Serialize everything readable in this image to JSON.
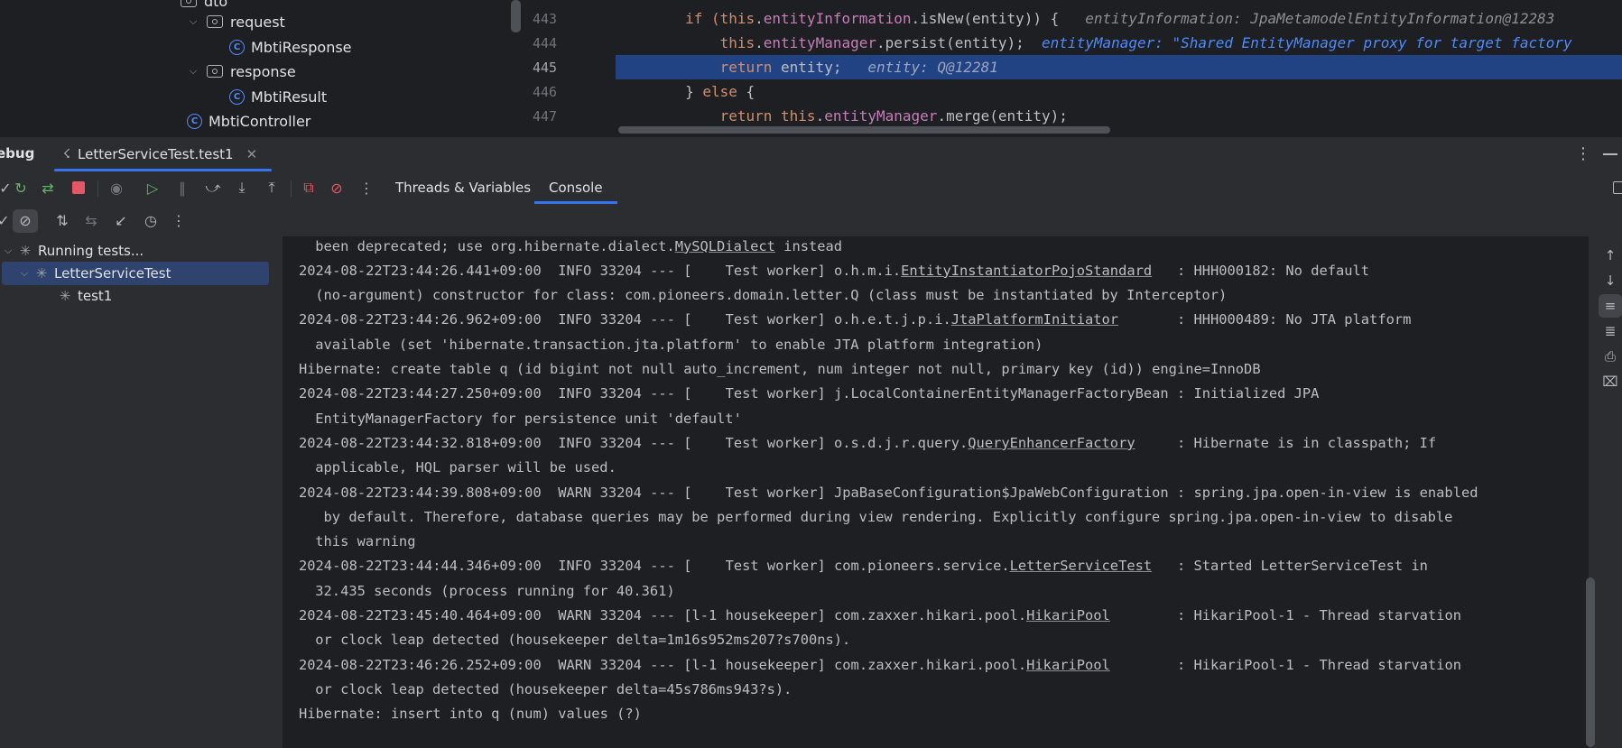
{
  "project_tree": {
    "items": [
      {
        "label": "dto",
        "type": "package"
      },
      {
        "label": "request",
        "type": "package"
      },
      {
        "label": "MbtiResponse",
        "type": "class"
      },
      {
        "label": "response",
        "type": "package"
      },
      {
        "label": "MbtiResult",
        "type": "class"
      },
      {
        "label": "MbtiController",
        "type": "class"
      }
    ]
  },
  "editor": {
    "line_numbers": [
      "443",
      "444",
      "445",
      "446",
      "447"
    ],
    "current_line": "445",
    "lines": [
      {
        "indent": "        ",
        "kw1": "if (",
        "this": "this",
        "mid": ".",
        "field": "entityInformation",
        "rest": ".isNew(entity)) {",
        "hint": "entityInformation: JpaMetamodelEntityInformation@12283"
      },
      {
        "indent": "            ",
        "this": "this",
        "mid": ".",
        "field": "entityManager",
        "rest": ".persist(entity);",
        "hint": "entityManager: \"Shared EntityManager proxy for target factory"
      },
      {
        "indent": "            ",
        "kw": "return",
        "rest": " entity;",
        "hint": "entity: Q@12281"
      },
      {
        "indent": "        ",
        "kw_pre": "} ",
        "kw": "else",
        "rest": " {"
      },
      {
        "indent": "            ",
        "kw": "return",
        "sp": " ",
        "this": "this",
        "mid": ".",
        "field": "entityManager",
        "rest": ".merge(entity);"
      }
    ]
  },
  "debug": {
    "tool_title": "ebug",
    "run_tab": "LetterServiceTest.test1",
    "tabs": {
      "threads": "Threads & Variables",
      "console": "Console"
    },
    "tests": {
      "root": "Running tests...",
      "class": "LetterServiceTest",
      "method": "test1"
    }
  },
  "console": {
    "lines": [
      {
        "t": " been deprecated; use org.hibernate.dialect.",
        "u": "MySQLDialect",
        "a": " instead",
        "cont": true
      },
      {
        "t": "2024-08-22T23:44:26.441+09:00  INFO 33204 --- [    Test worker] o.h.m.i.",
        "u": "EntityInstantiatorPojoStandard",
        "a": "   : HHH000182: No default"
      },
      {
        "t": " (no-argument) constructor for class: com.pioneers.domain.letter.Q (class must be instantiated by Interceptor)",
        "cont": true
      },
      {
        "t": "2024-08-22T23:44:26.962+09:00  INFO 33204 --- [    Test worker] o.h.e.t.j.p.i.",
        "u": "JtaPlatformInitiator",
        "a": "       : HHH000489: No JTA platform"
      },
      {
        "t": " available (set 'hibernate.transaction.jta.platform' to enable JTA platform integration)",
        "cont": true
      },
      {
        "t": "Hibernate: create table q (id bigint not null auto_increment, num integer not null, primary key (id)) engine=InnoDB"
      },
      {
        "t": "2024-08-22T23:44:27.250+09:00  INFO 33204 --- [    Test worker] j.LocalContainerEntityManagerFactoryBean : Initialized JPA"
      },
      {
        "t": " EntityManagerFactory for persistence unit 'default'",
        "cont": true
      },
      {
        "t": "2024-08-22T23:44:32.818+09:00  INFO 33204 --- [    Test worker] o.s.d.j.r.query.",
        "u": "QueryEnhancerFactory",
        "a": "     : Hibernate is in classpath; If"
      },
      {
        "t": " applicable, HQL parser will be used.",
        "cont": true
      },
      {
        "t": "2024-08-22T23:44:39.808+09:00  WARN 33204 --- [    Test worker] JpaBaseConfiguration$JpaWebConfiguration : spring.jpa.open-in-view is enabled"
      },
      {
        "t": "  by default. Therefore, database queries may be performed during view rendering. Explicitly configure spring.jpa.open-in-view to disable",
        "cont": true
      },
      {
        "t": " this warning",
        "cont": true
      },
      {
        "t": "2024-08-22T23:44:44.346+09:00  INFO 33204 --- [    Test worker] com.pioneers.service.",
        "u": "LetterServiceTest",
        "a": "   : Started LetterServiceTest in"
      },
      {
        "t": " 32.435 seconds (process running for 40.361)",
        "cont": true
      },
      {
        "t": "2024-08-22T23:45:40.464+09:00  WARN 33204 --- [l-1 housekeeper] com.zaxxer.hikari.pool.",
        "u": "HikariPool",
        "a": "        : HikariPool-1 - Thread starvation"
      },
      {
        "t": " or clock leap detected (housekeeper delta=1m16s952ms207?s700ns).",
        "cont": true
      },
      {
        "t": "2024-08-22T23:46:26.252+09:00  WARN 33204 --- [l-1 housekeeper] com.zaxxer.hikari.pool.",
        "u": "HikariPool",
        "a": "        : HikariPool-1 - Thread starvation"
      },
      {
        "t": " or clock leap detected (housekeeper delta=45s786ms943?s).",
        "cont": true
      },
      {
        "t": "Hibernate: insert into q (num) values (?)"
      }
    ]
  },
  "icons": {
    "class_letter": "C"
  },
  "colors": {
    "accent": "#3574f0",
    "selection": "#214283",
    "keyword": "#cf8e6d",
    "field": "#c77dbb"
  }
}
